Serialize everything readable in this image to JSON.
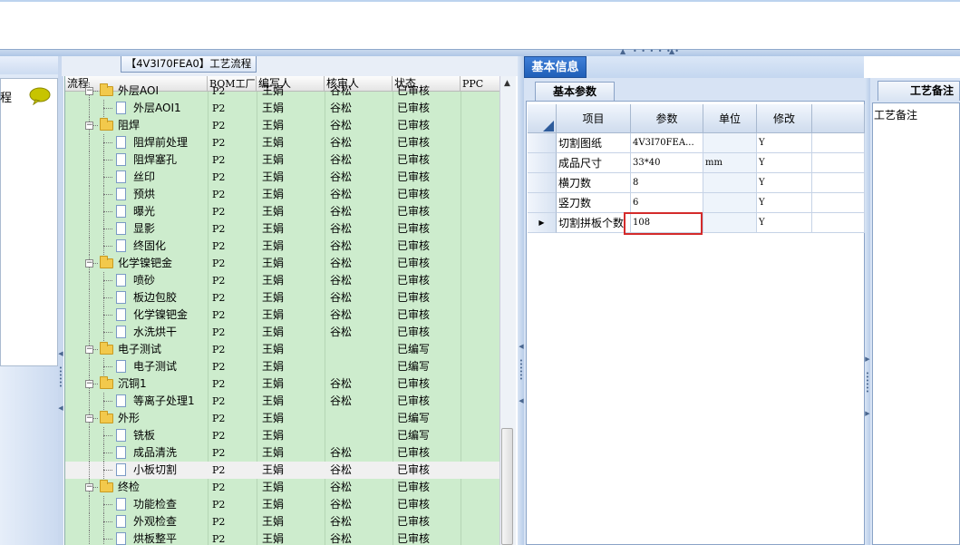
{
  "left_nav": {
    "label": "程"
  },
  "tree": {
    "title": "【4V3I70FEA0】工艺流程",
    "columns": [
      "流程",
      "BOM工厂",
      "编写人",
      "核审人",
      "状态",
      "PPC"
    ],
    "rows": [
      {
        "name": "外层AOI",
        "bom": "P2",
        "writer": "王娟",
        "reviewer": "谷松",
        "status": "已审核",
        "level": 1,
        "icon": "folder"
      },
      {
        "name": "外层AOI1",
        "bom": "P2",
        "writer": "王娟",
        "reviewer": "谷松",
        "status": "已审核",
        "level": 2,
        "icon": "document"
      },
      {
        "name": "阻焊",
        "bom": "P2",
        "writer": "王娟",
        "reviewer": "谷松",
        "status": "已审核",
        "level": 1,
        "icon": "folder"
      },
      {
        "name": "阻焊前处理",
        "bom": "P2",
        "writer": "王娟",
        "reviewer": "谷松",
        "status": "已审核",
        "level": 2,
        "icon": "document"
      },
      {
        "name": "阻焊塞孔",
        "bom": "P2",
        "writer": "王娟",
        "reviewer": "谷松",
        "status": "已审核",
        "level": 2,
        "icon": "document"
      },
      {
        "name": "丝印",
        "bom": "P2",
        "writer": "王娟",
        "reviewer": "谷松",
        "status": "已审核",
        "level": 2,
        "icon": "document"
      },
      {
        "name": "预烘",
        "bom": "P2",
        "writer": "王娟",
        "reviewer": "谷松",
        "status": "已审核",
        "level": 2,
        "icon": "document"
      },
      {
        "name": "曝光",
        "bom": "P2",
        "writer": "王娟",
        "reviewer": "谷松",
        "status": "已审核",
        "level": 2,
        "icon": "document"
      },
      {
        "name": "显影",
        "bom": "P2",
        "writer": "王娟",
        "reviewer": "谷松",
        "status": "已审核",
        "level": 2,
        "icon": "document"
      },
      {
        "name": "终固化",
        "bom": "P2",
        "writer": "王娟",
        "reviewer": "谷松",
        "status": "已审核",
        "level": 2,
        "icon": "document"
      },
      {
        "name": "化学镍钯金",
        "bom": "P2",
        "writer": "王娟",
        "reviewer": "谷松",
        "status": "已审核",
        "level": 1,
        "icon": "folder"
      },
      {
        "name": "喷砂",
        "bom": "P2",
        "writer": "王娟",
        "reviewer": "谷松",
        "status": "已审核",
        "level": 2,
        "icon": "document"
      },
      {
        "name": "板边包胶",
        "bom": "P2",
        "writer": "王娟",
        "reviewer": "谷松",
        "status": "已审核",
        "level": 2,
        "icon": "document"
      },
      {
        "name": "化学镍钯金",
        "bom": "P2",
        "writer": "王娟",
        "reviewer": "谷松",
        "status": "已审核",
        "level": 2,
        "icon": "document"
      },
      {
        "name": "水洗烘干",
        "bom": "P2",
        "writer": "王娟",
        "reviewer": "谷松",
        "status": "已审核",
        "level": 2,
        "icon": "document"
      },
      {
        "name": "电子测试",
        "bom": "P2",
        "writer": "王娟",
        "reviewer": "",
        "status": "已编写",
        "level": 1,
        "icon": "folder"
      },
      {
        "name": "电子测试",
        "bom": "P2",
        "writer": "王娟",
        "reviewer": "",
        "status": "已编写",
        "level": 2,
        "icon": "document"
      },
      {
        "name": "沉铜1",
        "bom": "P2",
        "writer": "王娟",
        "reviewer": "谷松",
        "status": "已审核",
        "level": 1,
        "icon": "folder"
      },
      {
        "name": "等离子处理1",
        "bom": "P2",
        "writer": "王娟",
        "reviewer": "谷松",
        "status": "已审核",
        "level": 2,
        "icon": "document"
      },
      {
        "name": "外形",
        "bom": "P2",
        "writer": "王娟",
        "reviewer": "",
        "status": "已编写",
        "level": 1,
        "icon": "folder"
      },
      {
        "name": "铣板",
        "bom": "P2",
        "writer": "王娟",
        "reviewer": "",
        "status": "已编写",
        "level": 2,
        "icon": "document"
      },
      {
        "name": "成品清洗",
        "bom": "P2",
        "writer": "王娟",
        "reviewer": "谷松",
        "status": "已审核",
        "level": 2,
        "icon": "document"
      },
      {
        "name": "小板切割",
        "bom": "P2",
        "writer": "王娟",
        "reviewer": "谷松",
        "status": "已审核",
        "level": 2,
        "icon": "document",
        "selected": true
      },
      {
        "name": "终检",
        "bom": "P2",
        "writer": "王娟",
        "reviewer": "谷松",
        "status": "已审核",
        "level": 1,
        "icon": "folder"
      },
      {
        "name": "功能检查",
        "bom": "P2",
        "writer": "王娟",
        "reviewer": "谷松",
        "status": "已审核",
        "level": 2,
        "icon": "document"
      },
      {
        "name": "外观检查",
        "bom": "P2",
        "writer": "王娟",
        "reviewer": "谷松",
        "status": "已审核",
        "level": 2,
        "icon": "document"
      },
      {
        "name": "烘板整平",
        "bom": "P2",
        "writer": "王娟",
        "reviewer": "谷松",
        "status": "已审核",
        "level": 2,
        "icon": "document"
      }
    ]
  },
  "basic": {
    "tab_label": "基本信息",
    "sub_tab_label": "基本参数",
    "columns": [
      "项目",
      "参数",
      "单位",
      "修改"
    ],
    "rows": [
      {
        "item": "切割图纸",
        "param": "4V3I70FEA...",
        "unit": "",
        "modify": "Y"
      },
      {
        "item": "成品尺寸",
        "param": "33*40",
        "unit": "mm",
        "modify": "Y"
      },
      {
        "item": "横刀数",
        "param": "8",
        "unit": "",
        "modify": "Y"
      },
      {
        "item": "竖刀数",
        "param": "6",
        "unit": "",
        "modify": "Y"
      },
      {
        "item": "切割拼板个数",
        "param": "108",
        "unit": "",
        "modify": "Y",
        "current": true
      }
    ]
  },
  "remarks": {
    "tab_label": "工艺备注",
    "field_label": "工艺备注"
  },
  "colors": {
    "tree_row_bg": "#cdeccd",
    "accent_tab": "#2b6cc4",
    "highlight_border": "#d42b2b"
  }
}
